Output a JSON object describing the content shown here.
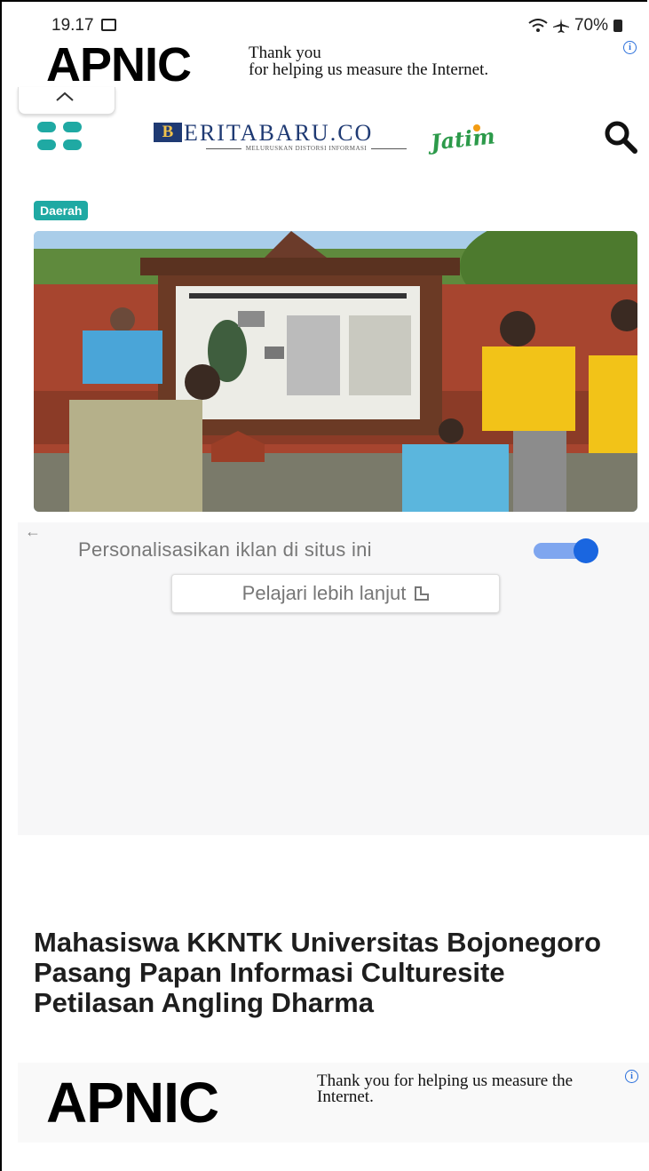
{
  "status_bar": {
    "time": "19.17",
    "battery": "70%"
  },
  "ad_top": {
    "logo": "APNIC",
    "text_line1": "Thank you",
    "text_line2": "for helping us measure the Internet."
  },
  "site": {
    "logo_word": "ERITABARU.CO",
    "logo_mark": "B",
    "tagline": "MELURUSKAN DISTORSI INFORMASI",
    "region": "Jatim"
  },
  "article": {
    "category": "Daerah",
    "title": "Mahasiswa KKNTK Universitas Bojonegoro Pasang Papan Informasi Culturesite Petilasan Angling Dharma"
  },
  "consent": {
    "label": "Personalisasikan iklan di situs ini",
    "toggle_on": true,
    "learn_more": "Pelajari lebih lanjut"
  },
  "ad_bottom": {
    "logo": "APNIC",
    "text": "Thank you for helping us measure the Internet."
  },
  "colors": {
    "accent": "#1fa9a3",
    "toggle": "#1a66e0",
    "brand_navy": "#1f3a73",
    "brand_green": "#2c9a4a"
  },
  "icons": [
    "gallery-icon",
    "wifi-icon",
    "airplane-icon",
    "battery-icon",
    "info-icon",
    "chevron-up-icon",
    "menu-grid-icon",
    "search-icon",
    "back-arrow-icon",
    "external-link-icon"
  ]
}
